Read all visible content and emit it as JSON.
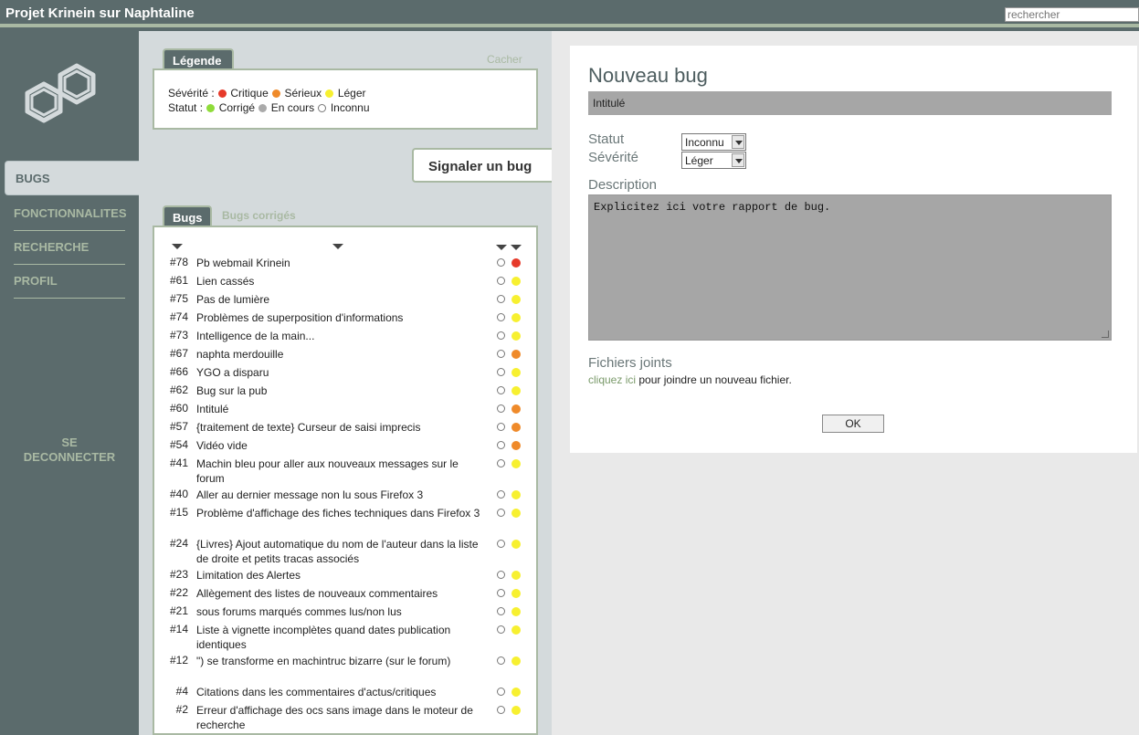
{
  "app": {
    "title": "Projet Krinein sur Naphtaline",
    "search_placeholder": "rechercher"
  },
  "sidebar": {
    "logo_icon": "naphthalene-logo-icon",
    "items": [
      {
        "label": "BUGS",
        "active": true
      },
      {
        "label": "FONCTIONNALITES"
      },
      {
        "label": "RECHERCHE"
      },
      {
        "label": "PROFIL"
      }
    ],
    "logout_line1": "SE",
    "logout_line2": "DECONNECTER"
  },
  "legend": {
    "tab_label": "Légende",
    "hide_label": "Cacher",
    "severity_label": "Sévérité :",
    "severity": [
      {
        "label": "Critique",
        "color": "#e63a2a"
      },
      {
        "label": "Sérieux",
        "color": "#ef8a2a"
      },
      {
        "label": "Léger",
        "color": "#f7f030"
      }
    ],
    "status_label": "Statut :",
    "status": [
      {
        "label": "Corrigé",
        "color": "#8fdc3a"
      },
      {
        "label": "En cours",
        "color": "#aaaaaa"
      },
      {
        "label": "Inconnu",
        "color": "#ffffff"
      }
    ]
  },
  "report_tab_label": "Signaler un bug",
  "bug_tabs": {
    "active": "Bugs",
    "other": "Bugs corrigés"
  },
  "bugs": [
    {
      "id": "#78",
      "title": "Pb webmail Krinein",
      "severity_color": "#e63a2a"
    },
    {
      "id": "#61",
      "title": "Lien cassés",
      "severity_color": "#f7f030"
    },
    {
      "id": "#75",
      "title": "Pas de lumière",
      "severity_color": "#f7f030"
    },
    {
      "id": "#74",
      "title": "Problèmes de superposition d'informations",
      "severity_color": "#f7f030"
    },
    {
      "id": "#73",
      "title": "Intelligence de la main...",
      "severity_color": "#f7f030"
    },
    {
      "id": "#67",
      "title": "naphta merdouille",
      "severity_color": "#ef8a2a"
    },
    {
      "id": "#66",
      "title": "YGO a disparu",
      "severity_color": "#f7f030"
    },
    {
      "id": "#62",
      "title": "Bug sur la pub",
      "severity_color": "#f7f030"
    },
    {
      "id": "#60",
      "title": "Intitulé",
      "severity_color": "#ef8a2a"
    },
    {
      "id": "#57",
      "title": "{traitement de texte} Curseur de saisi imprecis",
      "severity_color": "#ef8a2a"
    },
    {
      "id": "#54",
      "title": "Vidéo vide",
      "severity_color": "#ef8a2a"
    },
    {
      "id": "#41",
      "title": "Machin bleu pour aller aux nouveaux messages sur le forum",
      "severity_color": "#f7f030"
    },
    {
      "id": "#40",
      "title": "Aller au dernier message non lu sous Firefox 3",
      "severity_color": "#f7f030"
    },
    {
      "id": "#15",
      "title": "Problème d'affichage des fiches techniques dans Firefox 3",
      "severity_color": "#f7f030"
    },
    {
      "id": "#24",
      "title": "{Livres} Ajout automatique du nom de l'auteur dans la liste de droite et petits tracas associés",
      "severity_color": "#f7f030"
    },
    {
      "id": "#23",
      "title": "Limitation des Alertes",
      "severity_color": "#f7f030"
    },
    {
      "id": "#22",
      "title": "Allègement des listes de nouveaux commentaires",
      "severity_color": "#f7f030"
    },
    {
      "id": "#21",
      "title": "sous forums marqués commes lus/non lus",
      "severity_color": "#f7f030"
    },
    {
      "id": "#14",
      "title": "Liste à vignette incomplètes quand dates publication identiques",
      "severity_color": "#f7f030"
    },
    {
      "id": "#12",
      "title": "\") se transforme en machintruc bizarre (sur le forum)",
      "severity_color": "#f7f030"
    },
    {
      "id": "#4",
      "title": "Citations dans les commentaires d'actus/critiques",
      "severity_color": "#f7f030"
    },
    {
      "id": "#2",
      "title": "Erreur d'affichage des ocs sans image dans le moteur de recherche",
      "severity_color": "#f7f030"
    }
  ],
  "form": {
    "heading": "Nouveau bug",
    "title_value": "Intitulé",
    "status_label": "Statut",
    "status_value": "Inconnu",
    "severity_label": "Sévérité",
    "severity_value": "Léger",
    "description_label": "Description",
    "description_value": "Explicitez ici votre rapport de bug.",
    "attachments_label": "Fichiers joints",
    "attach_link": "cliquez ici",
    "attach_text": " pour joindre un nouveau fichier.",
    "submit_label": "OK"
  }
}
